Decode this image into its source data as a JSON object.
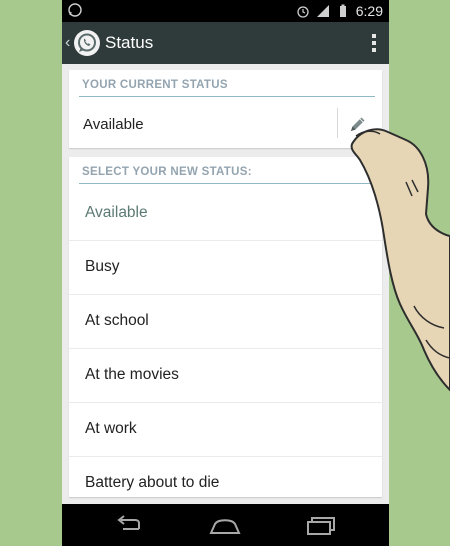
{
  "statusbar": {
    "time": "6:29"
  },
  "actionbar": {
    "title": "Status"
  },
  "current": {
    "header": "YOUR CURRENT STATUS",
    "value": "Available"
  },
  "select": {
    "header": "SELECT YOUR NEW STATUS:",
    "items": [
      {
        "label": "Available",
        "selected": true
      },
      {
        "label": "Busy"
      },
      {
        "label": "At school"
      },
      {
        "label": "At the movies"
      },
      {
        "label": "At work"
      },
      {
        "label": "Battery about to die"
      }
    ]
  },
  "colors": {
    "background": "#a8c98d",
    "actionbar": "#2f3a3a",
    "accent": "#8fb7c5"
  }
}
